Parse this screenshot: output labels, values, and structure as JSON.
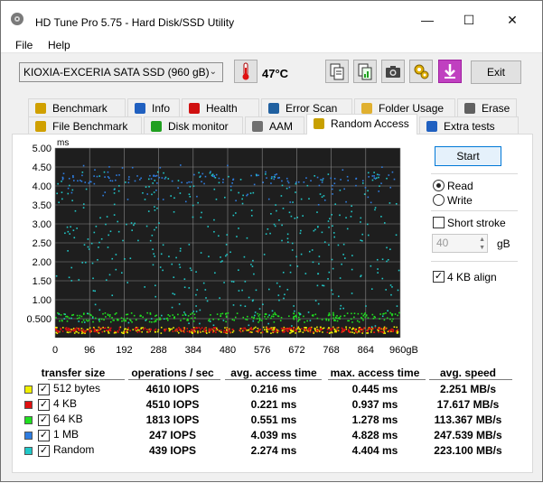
{
  "window": {
    "title": "HD Tune Pro 5.75 - Hard Disk/SSD Utility"
  },
  "menu": {
    "file": "File",
    "help": "Help"
  },
  "toolbar": {
    "drive": "KIOXIA-EXCERIA SATA SSD (960 gB)",
    "temperature": "47°C",
    "exit_label": "Exit"
  },
  "tabs_top": [
    {
      "label": "Benchmark",
      "icon": "benchmark-icon"
    },
    {
      "label": "Info",
      "icon": "info-icon"
    },
    {
      "label": "Health",
      "icon": "health-icon"
    },
    {
      "label": "Error Scan",
      "icon": "error-scan-icon"
    },
    {
      "label": "Folder Usage",
      "icon": "folder-icon"
    },
    {
      "label": "Erase",
      "icon": "erase-icon"
    }
  ],
  "tabs_bottom": [
    {
      "label": "File Benchmark",
      "icon": "file-benchmark-icon"
    },
    {
      "label": "Disk monitor",
      "icon": "disk-monitor-icon"
    },
    {
      "label": "AAM",
      "icon": "speaker-icon"
    },
    {
      "label": "Random Access",
      "icon": "random-access-icon"
    },
    {
      "label": "Extra tests",
      "icon": "extra-tests-icon"
    }
  ],
  "active_tab": "Random Access",
  "controls": {
    "start_label": "Start",
    "read_label": "Read",
    "write_label": "Write",
    "short_stroke_label": "Short stroke",
    "short_stroke_value": "40",
    "unit_label": "gB",
    "align_label": "4 KB align"
  },
  "chart_data": {
    "type": "scatter",
    "ylabel": "ms",
    "xlabel": "gB",
    "ylim": [
      0,
      5.0
    ],
    "xlim": [
      0,
      960
    ],
    "y_ticks": [
      "5.00",
      "4.50",
      "4.00",
      "3.50",
      "3.00",
      "2.50",
      "2.00",
      "1.50",
      "1.00",
      "0.500"
    ],
    "x_ticks": [
      "0",
      "96",
      "192",
      "288",
      "384",
      "480",
      "576",
      "672",
      "768",
      "864",
      "960gB"
    ],
    "grid": true,
    "series": [
      {
        "name": "512 bytes",
        "color": "#f0f000",
        "y_mean": 0.216,
        "y_spread": [
          0.15,
          0.32
        ]
      },
      {
        "name": "4 KB",
        "color": "#e01010",
        "y_mean": 0.221,
        "y_spread": [
          0.17,
          0.3
        ]
      },
      {
        "name": "64 KB",
        "color": "#20e020",
        "y_mean": 0.551,
        "y_spread": [
          0.45,
          0.7
        ]
      },
      {
        "name": "1 MB",
        "color": "#2f7de0",
        "y_mean": 4.039,
        "y_spread": [
          3.5,
          4.6
        ]
      },
      {
        "name": "Random",
        "color": "#20c8c8",
        "y_mean": 2.274,
        "y_spread": [
          0.3,
          4.4
        ]
      }
    ]
  },
  "results": {
    "headers": [
      "transfer size",
      "operations / sec",
      "avg. access time",
      "max. access time",
      "avg. speed"
    ],
    "rows": [
      {
        "label": "512 bytes",
        "color": "#f0f000",
        "ops": "4610 IOPS",
        "avg": "0.216 ms",
        "max": "0.445 ms",
        "speed": "2.251 MB/s"
      },
      {
        "label": "4 KB",
        "color": "#e01010",
        "ops": "4510 IOPS",
        "avg": "0.221 ms",
        "max": "0.937 ms",
        "speed": "17.617 MB/s"
      },
      {
        "label": "64 KB",
        "color": "#20e020",
        "ops": "1813 IOPS",
        "avg": "0.551 ms",
        "max": "1.278 ms",
        "speed": "113.367 MB/s"
      },
      {
        "label": "1 MB",
        "color": "#2f7de0",
        "ops": "247 IOPS",
        "avg": "4.039 ms",
        "max": "4.828 ms",
        "speed": "247.539 MB/s"
      },
      {
        "label": "Random",
        "color": "#20c8c8",
        "ops": "439 IOPS",
        "avg": "2.274 ms",
        "max": "4.404 ms",
        "speed": "223.100 MB/s"
      }
    ]
  }
}
